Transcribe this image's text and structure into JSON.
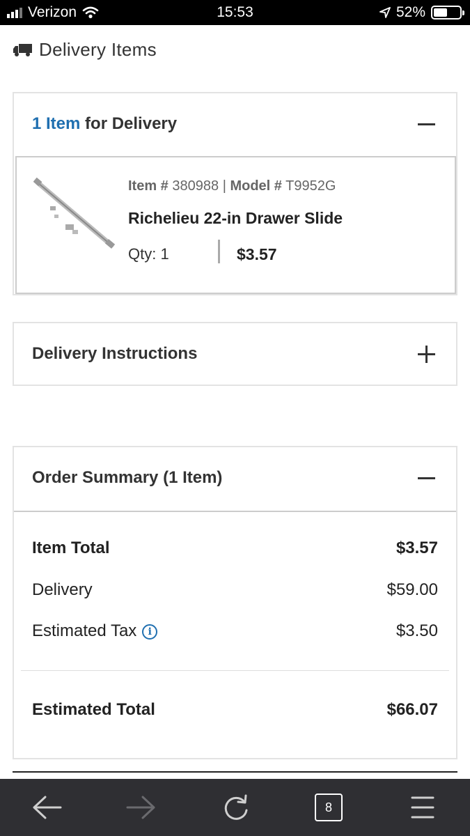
{
  "status_bar": {
    "carrier": "Verizon",
    "time": "15:53",
    "battery_percent": "52%",
    "battery_level": 0.52
  },
  "header": {
    "title": "Delivery Items",
    "icon": "truck-icon"
  },
  "delivery_section": {
    "count_label": "1 Item",
    "title_suffix": " for Delivery",
    "expanded": true,
    "item": {
      "item_label": "Item #",
      "item_number": "380988",
      "separator": "|",
      "model_label": "Model #",
      "model_number": "T9952G",
      "name": "Richelieu 22-in Drawer Slide",
      "qty_label": "Qty: 1",
      "price": "$3.57"
    }
  },
  "instructions_section": {
    "title": "Delivery Instructions",
    "expanded": false
  },
  "summary": {
    "title": "Order Summary (1 Item)",
    "rows": [
      {
        "label": "Item Total",
        "value": "$3.57"
      },
      {
        "label": "Delivery",
        "value": "$59.00"
      },
      {
        "label": "Estimated Tax",
        "value": "$3.50"
      }
    ],
    "total": {
      "label": "Estimated Total",
      "value": "$66.07"
    }
  },
  "toolbar": {
    "tab_count": "8",
    "buttons": [
      "back-arrow-icon",
      "forward-arrow-icon",
      "reload-icon",
      "tabs-icon",
      "menu-icon"
    ]
  },
  "colors": {
    "accent": "#1f6fb0",
    "toolbar_bg": "#2f2f33"
  }
}
